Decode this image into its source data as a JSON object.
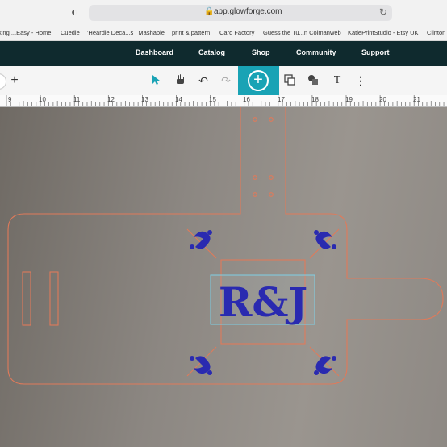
{
  "browser": {
    "url": "app.glowforge.com",
    "bookmarks": [
      "king ...Easy - Home",
      "Cuedle",
      "'Heardle Deca...s | Mashable",
      "print & pattern",
      "Card Factory",
      "Guess the Tu...n Colmanweb",
      "KatiePrintStudio - Etsy UK",
      "Clinton"
    ]
  },
  "nav": {
    "items": [
      "Dashboard",
      "Catalog",
      "Shop",
      "Community",
      "Support"
    ]
  },
  "toolbar": {
    "text_tool": "T"
  },
  "ruler": {
    "labels": [
      "9",
      "10",
      "11",
      "12",
      "13",
      "14",
      "15",
      "16",
      "17",
      "18",
      "19",
      "20",
      "21"
    ]
  },
  "design": {
    "monogram": "R&J",
    "cut_color": "#e07a5a",
    "engrave_color": "#2a2ab0",
    "select_color": "#7fd0e6"
  }
}
